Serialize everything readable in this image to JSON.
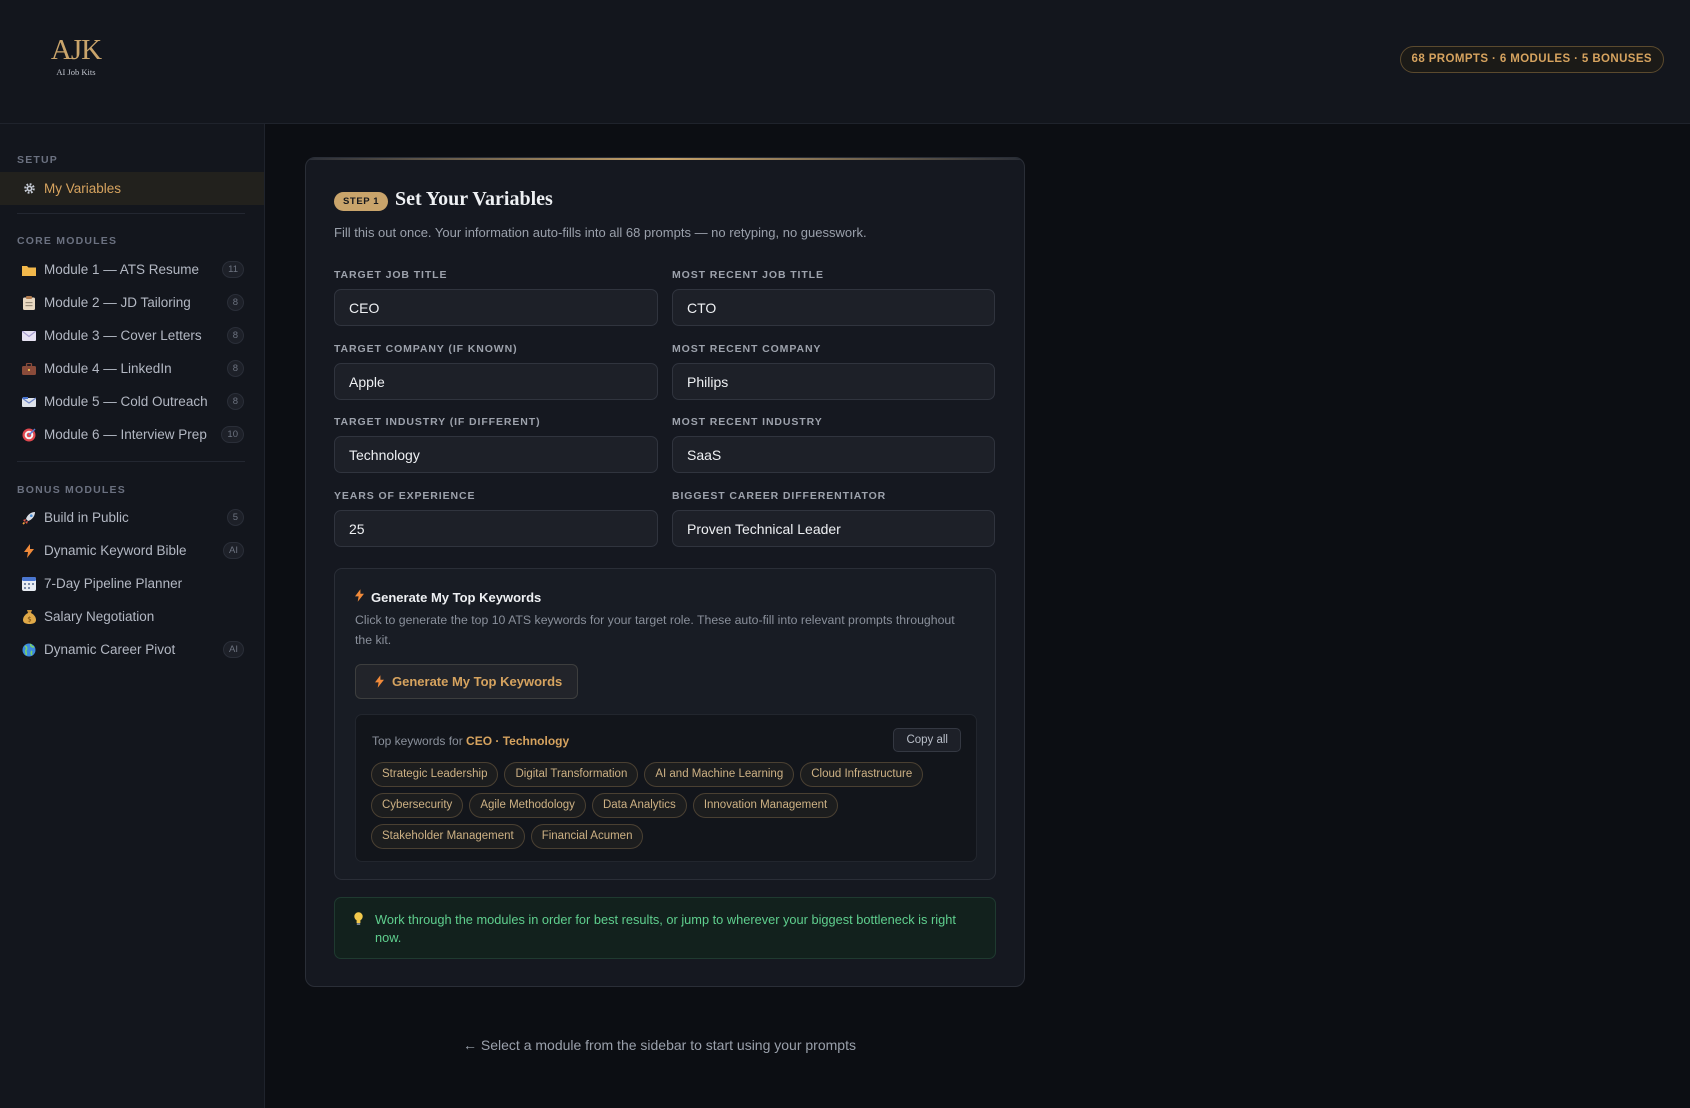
{
  "header": {
    "logo_mark": "AJK",
    "logo_sub": "AI Job Kits",
    "stats": "68 PROMPTS · 6 MODULES · 5 BONUSES"
  },
  "sidebar": {
    "setup_label": "SETUP",
    "my_variables": "My Variables",
    "core_label": "CORE MODULES",
    "core_items": [
      {
        "label": "Module 1 — ATS Resume",
        "badge": "11",
        "icon": "folder-icon"
      },
      {
        "label": "Module 2 — JD Tailoring",
        "badge": "8",
        "icon": "clipboard-icon"
      },
      {
        "label": "Module 3 — Cover Letters",
        "badge": "8",
        "icon": "envelope-icon"
      },
      {
        "label": "Module 4 — LinkedIn",
        "badge": "8",
        "icon": "briefcase-icon"
      },
      {
        "label": "Module 5 — Cold Outreach",
        "badge": "8",
        "icon": "mail-icon"
      },
      {
        "label": "Module 6 — Interview Prep",
        "badge": "10",
        "icon": "target-icon"
      }
    ],
    "bonus_label": "BONUS MODULES",
    "bonus_items": [
      {
        "label": "Build in Public",
        "badge": "5",
        "icon": "rocket-icon"
      },
      {
        "label": "Dynamic Keyword Bible",
        "badge": "AI",
        "icon": "bolt-icon"
      },
      {
        "label": "7-Day Pipeline Planner",
        "badge": "",
        "icon": "calendar-icon"
      },
      {
        "label": "Salary Negotiation",
        "badge": "",
        "icon": "money-bag-icon"
      },
      {
        "label": "Dynamic Career Pivot",
        "badge": "AI",
        "icon": "globe-icon"
      }
    ]
  },
  "card": {
    "step": "STEP 1",
    "title": "Set Your Variables",
    "subtitle": "Fill this out once. Your information auto-fills into all 68 prompts — no retyping, no guesswork.",
    "fields": {
      "target_job_title": {
        "label": "TARGET JOB TITLE",
        "value": "CEO"
      },
      "recent_job_title": {
        "label": "MOST RECENT JOB TITLE",
        "value": "CTO"
      },
      "target_company": {
        "label": "TARGET COMPANY (IF KNOWN)",
        "value": "Apple"
      },
      "recent_company": {
        "label": "MOST RECENT COMPANY",
        "value": "Philips"
      },
      "target_industry": {
        "label": "TARGET INDUSTRY (IF DIFFERENT)",
        "value": "Technology"
      },
      "recent_industry": {
        "label": "MOST RECENT INDUSTRY",
        "value": "SaaS"
      },
      "years_experience": {
        "label": "YEARS OF EXPERIENCE",
        "value": "25"
      },
      "differentiator": {
        "label": "BIGGEST CAREER DIFFERENTIATOR",
        "value": "Proven Technical Leader"
      }
    },
    "keywords": {
      "title": "Generate My Top Keywords",
      "description": "Click to generate the top 10 ATS keywords for your target role. These auto-fill into relevant prompts throughout the kit.",
      "button": "Generate My Top Keywords",
      "for_prefix": "Top keywords for",
      "for_value": "CEO · Technology",
      "copy_all": "Copy all",
      "chips": [
        "Strategic Leadership",
        "Digital Transformation",
        "AI and Machine Learning",
        "Cloud Infrastructure",
        "Cybersecurity",
        "Agile Methodology",
        "Data Analytics",
        "Innovation Management",
        "Stakeholder Management",
        "Financial Acumen"
      ]
    },
    "tip": "Work through the modules in order for best results, or jump to wherever your biggest bottleneck is right now."
  },
  "bottom_hint": "← Select a module from the sidebar to start using your prompts",
  "colors": {
    "accent": "#c9a46b",
    "accent_text": "#d6a35f",
    "tip_green": "#5fcf8e",
    "bolt": "#f08a3a"
  }
}
